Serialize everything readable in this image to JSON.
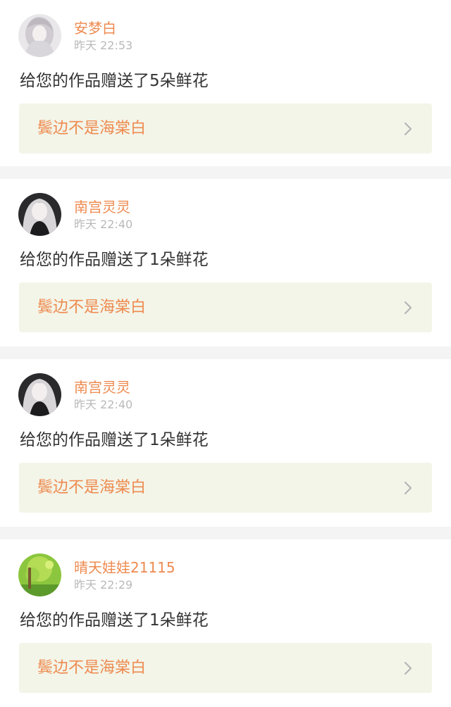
{
  "notifications": [
    {
      "user": "安梦白",
      "time": "昨天 22:53",
      "message": "给您的作品赠送了5朵鲜花",
      "work_title": "鬓边不是海棠白",
      "avatar": "avatar-silver-hair-girl"
    },
    {
      "user": "南宫灵灵",
      "time": "昨天 22:40",
      "message": "给您的作品赠送了1朵鲜花",
      "work_title": "鬓边不是海棠白",
      "avatar": "avatar-dark-anime-girl"
    },
    {
      "user": "南宫灵灵",
      "time": "昨天 22:40",
      "message": "给您的作品赠送了1朵鲜花",
      "work_title": "鬓边不是海棠白",
      "avatar": "avatar-dark-anime-girl"
    },
    {
      "user": "晴天娃娃21115",
      "time": "昨天 22:29",
      "message": "给您的作品赠送了1朵鲜花",
      "work_title": "鬓边不是海棠白",
      "avatar": "avatar-green-forest"
    }
  ],
  "icons": {
    "chevron": "chevron-right-icon"
  },
  "colors": {
    "accent": "#ee8a4f",
    "time": "#b9b9b9",
    "text": "#333333",
    "link_background": "#f3f5e9",
    "page_background": "#f4f4f4"
  }
}
